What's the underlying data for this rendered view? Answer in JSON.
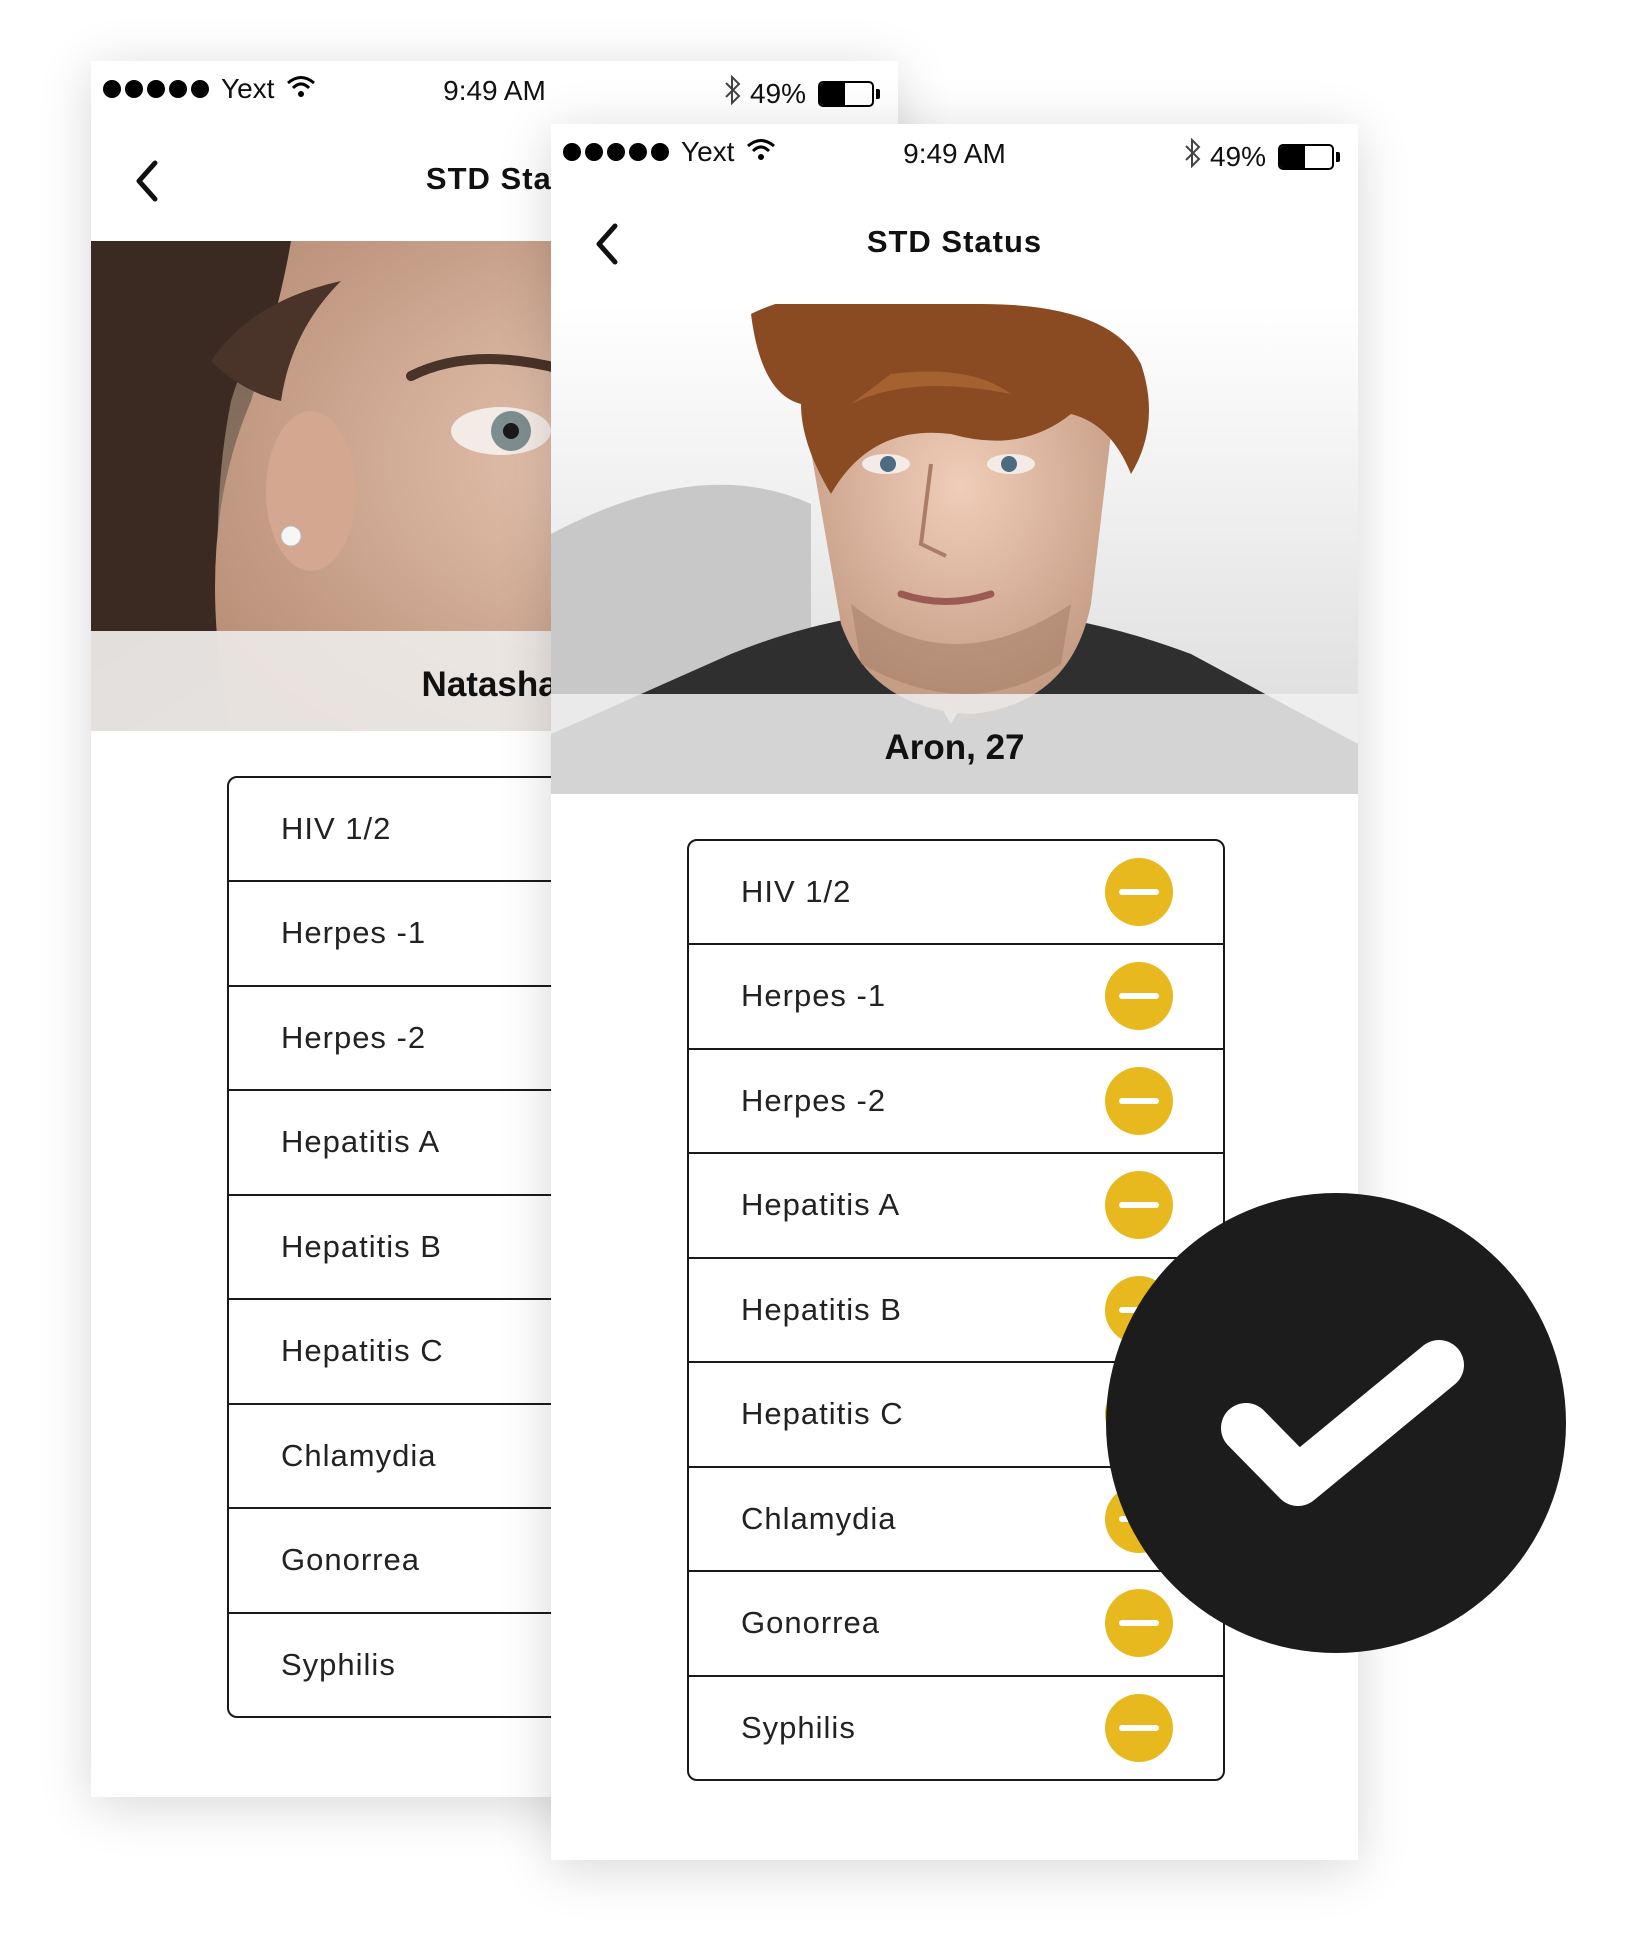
{
  "colors": {
    "accent_yellow": "#E7B91F",
    "badge_dark": "#1c1c1c",
    "text": "#111111"
  },
  "screens": [
    {
      "id": "back",
      "status_bar": {
        "carrier": "Yext",
        "time": "9:49 AM",
        "battery": "49%",
        "battery_level": 0.49,
        "signal_dots": 5
      },
      "nav": {
        "title": "STD Stat",
        "back_icon": "chevron-left-icon"
      },
      "profile": {
        "name": "Natasha,"
      },
      "std_items": [
        {
          "label": "HIV 1/2"
        },
        {
          "label": "Herpes -1"
        },
        {
          "label": "Herpes -2"
        },
        {
          "label": "Hepatitis A"
        },
        {
          "label": "Hepatitis B"
        },
        {
          "label": "Hepatitis C"
        },
        {
          "label": "Chlamydia"
        },
        {
          "label": "Gonorrea"
        },
        {
          "label": "Syphilis"
        }
      ]
    },
    {
      "id": "front",
      "status_bar": {
        "carrier": "Yext",
        "time": "9:49 AM",
        "battery": "49%",
        "battery_level": 0.49,
        "signal_dots": 5
      },
      "nav": {
        "title": "STD Status",
        "back_icon": "chevron-left-icon"
      },
      "profile": {
        "name": "Aron, 27"
      },
      "std_items": [
        {
          "label": "HIV 1/2",
          "status_icon": "minus-circle-icon"
        },
        {
          "label": "Herpes -1",
          "status_icon": "minus-circle-icon"
        },
        {
          "label": "Herpes -2",
          "status_icon": "minus-circle-icon"
        },
        {
          "label": "Hepatitis A",
          "status_icon": "minus-circle-icon"
        },
        {
          "label": "Hepatitis B",
          "status_icon": "minus-circle-icon"
        },
        {
          "label": "Hepatitis C",
          "status_icon": "minus-circle-icon"
        },
        {
          "label": "Chlamydia",
          "status_icon": "minus-circle-icon"
        },
        {
          "label": "Gonorrea",
          "status_icon": "minus-circle-icon"
        },
        {
          "label": "Syphilis",
          "status_icon": "minus-circle-icon"
        }
      ]
    }
  ],
  "badge": {
    "icon": "checkmark-icon"
  }
}
